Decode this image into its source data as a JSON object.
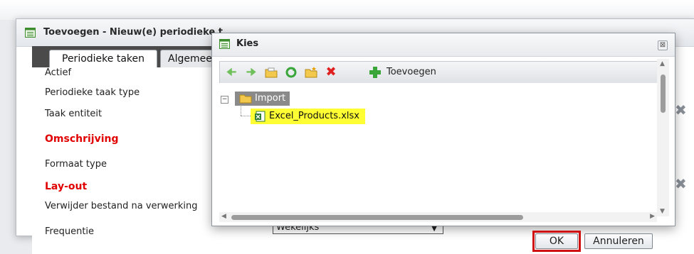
{
  "background_window": {
    "title": "Toevoegen - Nieuw(e) periodieke t",
    "tabs": [
      {
        "label": "Periodieke taken"
      },
      {
        "label": "Algemeen"
      }
    ],
    "fields": [
      {
        "label": "Actief"
      },
      {
        "label": "Periodieke taak type"
      },
      {
        "label": "Taak entiteit"
      },
      {
        "label": "Omschrijving"
      },
      {
        "label": "Formaat type"
      },
      {
        "label": "Lay-out"
      },
      {
        "label": "Verwijder bestand na verwerking"
      },
      {
        "label": "Frequentie"
      }
    ],
    "frequency_select_value": "Wekelijks"
  },
  "dialog": {
    "title": "Kies",
    "close_glyph": "⊠",
    "toolbar": {
      "add_label": "Toevoegen"
    },
    "tree": {
      "root": {
        "label": "Import",
        "expanded": true
      },
      "children": [
        {
          "label": "Excel_Products.xlsx",
          "selected": true
        }
      ]
    },
    "buttons": {
      "ok": "OK",
      "cancel": "Annuleren"
    }
  },
  "colors": {
    "section_label": "#e00000",
    "selected_file_highlight": "#ffff33",
    "ok_focus_outline": "#d01010"
  }
}
